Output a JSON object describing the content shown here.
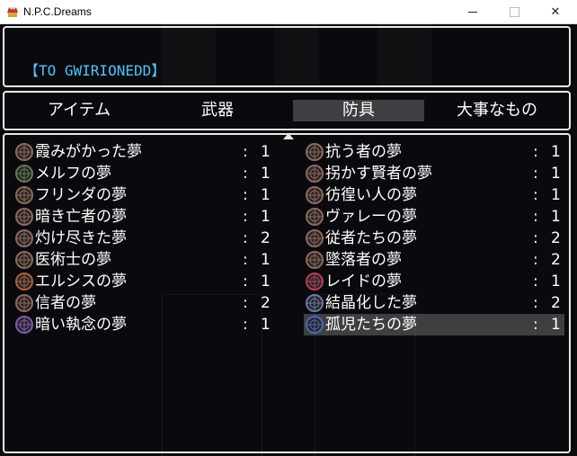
{
  "window": {
    "title": "N.P.C.Dreams"
  },
  "help": {
    "text": "【TO GWIRIONEDD】"
  },
  "tabs": [
    {
      "label": "アイテム",
      "selected": false
    },
    {
      "label": "武器",
      "selected": false
    },
    {
      "label": "防具",
      "selected": true
    },
    {
      "label": "大事なもの",
      "selected": false
    }
  ],
  "items_left": [
    {
      "name": "霞みがかった夢",
      "qty": "1",
      "icon_color": "#8a6a5a"
    },
    {
      "name": "メルフの夢",
      "qty": "1",
      "icon_color": "#5e7a52"
    },
    {
      "name": "フリンダの夢",
      "qty": "1",
      "icon_color": "#8a6a5a"
    },
    {
      "name": "暗き亡者の夢",
      "qty": "1",
      "icon_color": "#8a6a5a"
    },
    {
      "name": "灼け尽きた夢",
      "qty": "2",
      "icon_color": "#8a6a5a"
    },
    {
      "name": "医術士の夢",
      "qty": "1",
      "icon_color": "#8a6a5a"
    },
    {
      "name": "エルシスの夢",
      "qty": "1",
      "icon_color": "#a8633a"
    },
    {
      "name": "信者の夢",
      "qty": "2",
      "icon_color": "#8a6a5a"
    },
    {
      "name": "暗い執念の夢",
      "qty": "1",
      "icon_color": "#7a5ab0"
    }
  ],
  "items_right": [
    {
      "name": "抗う者の夢",
      "qty": "1",
      "icon_color": "#8a6a5a"
    },
    {
      "name": "拐かす賢者の夢",
      "qty": "1",
      "icon_color": "#8a6a5a"
    },
    {
      "name": "彷徨い人の夢",
      "qty": "1",
      "icon_color": "#8a6a5a"
    },
    {
      "name": "ヴァレーの夢",
      "qty": "1",
      "icon_color": "#8a6a5a"
    },
    {
      "name": "従者たちの夢",
      "qty": "2",
      "icon_color": "#8a6a5a"
    },
    {
      "name": "墜落者の夢",
      "qty": "2",
      "icon_color": "#8a6a5a"
    },
    {
      "name": "レイドの夢",
      "qty": "1",
      "icon_color": "#b0405a"
    },
    {
      "name": "結晶化した夢",
      "qty": "2",
      "icon_color": "#6a7aa8"
    },
    {
      "name": "孤児たちの夢",
      "qty": "1",
      "icon_color": "#4a6ab0",
      "selected": true
    }
  ],
  "separator": ":",
  "colors": {
    "help_text": "#49c6ff",
    "border": "#e8e8e8"
  }
}
